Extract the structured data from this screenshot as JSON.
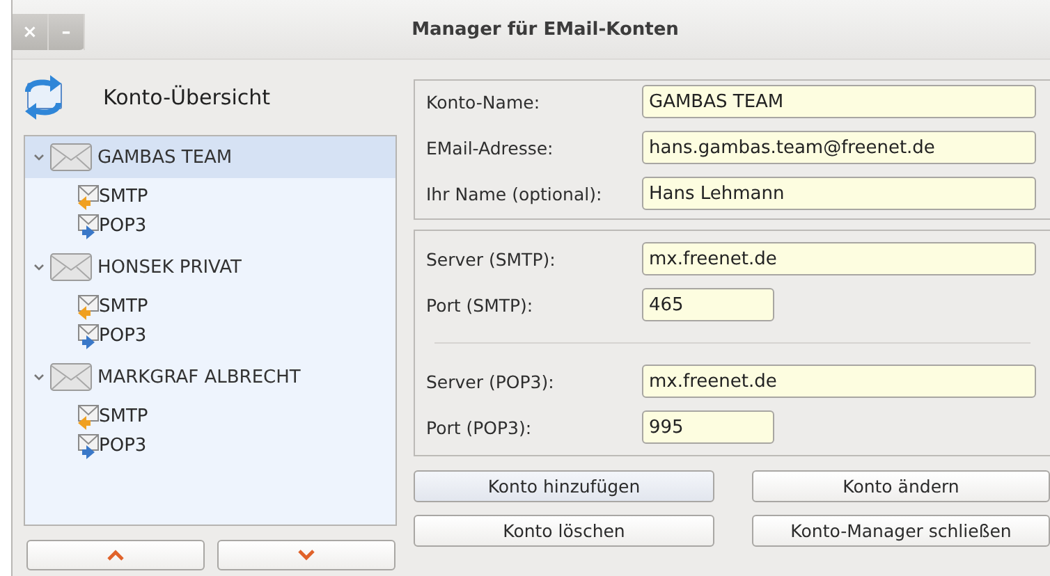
{
  "window": {
    "title": "Manager für EMail-Konten",
    "controls": [
      "×",
      "–"
    ]
  },
  "overview": {
    "title": "Konto-Übersicht"
  },
  "accounts": [
    {
      "name": "GAMBAS TEAM",
      "expanded": true,
      "selected": true,
      "children": [
        {
          "kind": "smtp",
          "label": "SMTP"
        },
        {
          "kind": "pop3",
          "label": "POP3"
        }
      ]
    },
    {
      "name": "HONSEK PRIVAT",
      "expanded": true,
      "selected": false,
      "children": [
        {
          "kind": "smtp",
          "label": "SMTP"
        },
        {
          "kind": "pop3",
          "label": "POP3"
        }
      ]
    },
    {
      "name": "MARKGRAF ALBRECHT",
      "expanded": true,
      "selected": false,
      "children": [
        {
          "kind": "smtp",
          "label": "SMTP"
        },
        {
          "kind": "pop3",
          "label": "POP3"
        }
      ]
    }
  ],
  "account_form": [
    {
      "label": "Konto-Name:",
      "value": "GAMBAS TEAM",
      "kind": "wide"
    },
    {
      "label": "EMail-Adresse:",
      "value": "hans.gambas.team@freenet.de",
      "kind": "wide"
    },
    {
      "label": "Ihr Name (optional):",
      "value": "Hans Lehmann",
      "kind": "wide"
    }
  ],
  "server_groups": [
    [
      {
        "label": "Server (SMTP):",
        "value": "mx.freenet.de",
        "kind": "wide"
      },
      {
        "label": "Port (SMTP):",
        "value": "465",
        "kind": "short"
      }
    ],
    [
      {
        "label": "Server (POP3):",
        "value": "mx.freenet.de",
        "kind": "wide"
      },
      {
        "label": "Port (POP3):",
        "value": "995",
        "kind": "short"
      }
    ]
  ],
  "buttons": [
    {
      "label": "Konto hinzufügen",
      "focused": true
    },
    {
      "label": "Konto ändern",
      "focused": false
    },
    {
      "label": "Konto löschen",
      "focused": false
    },
    {
      "label": "Konto-Manager schließen",
      "focused": false
    }
  ]
}
